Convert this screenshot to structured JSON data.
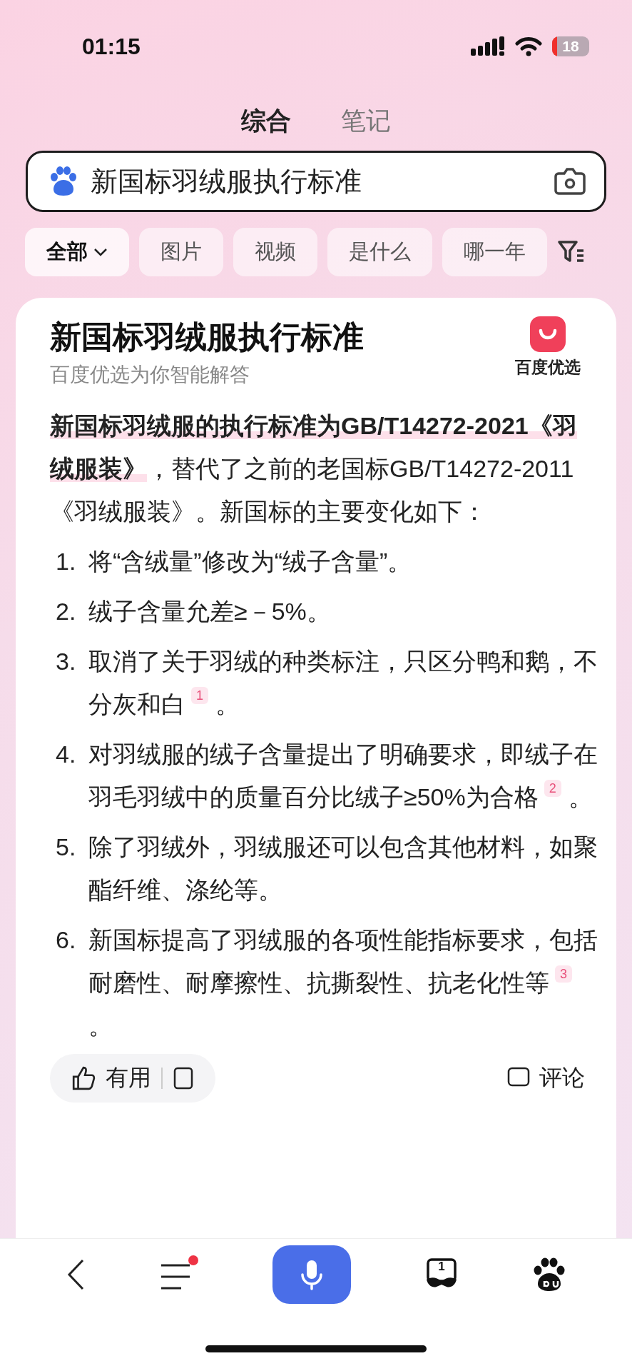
{
  "status_bar": {
    "time": "01:15",
    "battery": "18"
  },
  "tabs": [
    {
      "label": "综合",
      "selected": true
    },
    {
      "label": "笔记",
      "selected": false
    }
  ],
  "search": {
    "value": "新国标羽绒服执行标准"
  },
  "filters": [
    {
      "label": "全部",
      "selected": true
    },
    {
      "label": "图片",
      "selected": false
    },
    {
      "label": "视频",
      "selected": false
    },
    {
      "label": "是什么",
      "selected": false
    },
    {
      "label": "哪一年",
      "selected": false
    }
  ],
  "answer": {
    "title": "新国标羽绒服执行标准",
    "subtitle": "百度优选为你智能解答",
    "brand": "百度优选",
    "intro": "**新国标羽绒服的执行标准为GB/T14272-2021《羽绒服装》**，替代了之前的老国标GB/T14272-2011《羽绒服装》。新国标的主要变化如下：",
    "items": [
      {
        "num": "1.",
        "text": "将“含绒量”修改为“绒子含量”。"
      },
      {
        "num": "2.",
        "text": "绒子含量允差≥－5%。"
      },
      {
        "num": "3.",
        "text": "取消了关于羽绒的种类标注，只区分鸭和鹅，不分灰和白$^{1}$。"
      },
      {
        "num": "4.",
        "text": "对羽绒服的绒子含量提出了明确要求，即绒子在羽毛羽绒中的质量百分比绒子≥50%为合格$^{2}$。"
      },
      {
        "num": "5.",
        "text": "除了羽绒外，羽绒服还可以包含其他材料，如聚酯纤维、涤纶等。"
      },
      {
        "num": "6.",
        "text": "新国标提高了羽绒服的各项性能指标要求，包括耐磨性、耐摩擦性、抗撕裂性、抗老化性等$^{3}$。"
      }
    ],
    "actions": {
      "useful": "有用",
      "comment": "评论"
    }
  },
  "bottom_nav": {
    "menu_notification": true,
    "tab_count": "1"
  }
}
